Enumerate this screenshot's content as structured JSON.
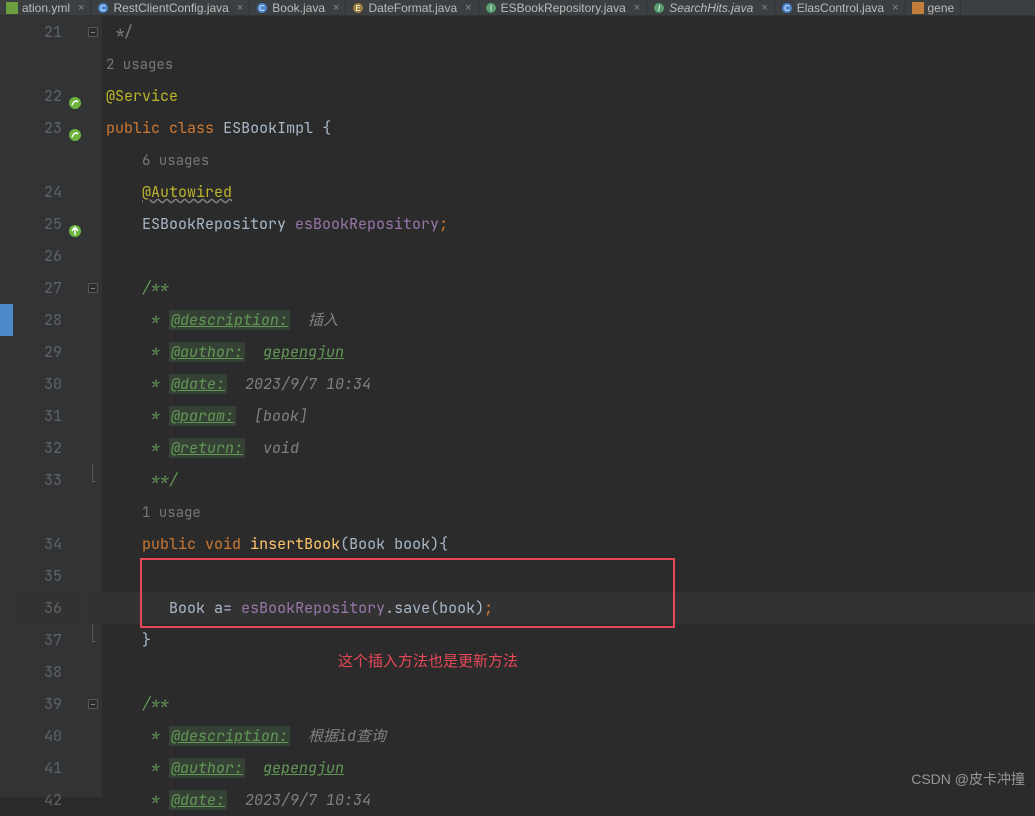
{
  "tabs": [
    {
      "label": "ation.yml",
      "icon": "yml",
      "close": true,
      "italic": false
    },
    {
      "label": "RestClientConfig.java",
      "icon": "java-class",
      "close": true,
      "italic": false
    },
    {
      "label": "Book.java",
      "icon": "java-class",
      "close": true,
      "italic": false
    },
    {
      "label": "DateFormat.java",
      "icon": "java-enum",
      "close": true,
      "italic": false
    },
    {
      "label": "ESBookRepository.java",
      "icon": "java-interface",
      "close": true,
      "italic": false
    },
    {
      "label": "SearchHits.java",
      "icon": "java-interface",
      "close": true,
      "italic": true
    },
    {
      "label": "ElasControl.java",
      "icon": "java-class",
      "close": true,
      "italic": false
    },
    {
      "label": "gene",
      "icon": "xml",
      "close": false,
      "italic": false
    }
  ],
  "watermark": "CSDN @皮卡冲撞",
  "annotation": {
    "text": "这个插入方法也是更新方法"
  },
  "lines": [
    {
      "ln": "21",
      "marks": [
        "fold-minus"
      ],
      "tokens": [
        {
          "t": " */",
          "cls": "c-c"
        }
      ]
    },
    {
      "ln": "",
      "tokens": [
        {
          "t": "2 usages",
          "cls": "c-usage"
        }
      ]
    },
    {
      "ln": "22",
      "gicon": "green-spring",
      "tokens": [
        {
          "t": "@Service",
          "cls": "c-ann"
        }
      ]
    },
    {
      "ln": "23",
      "gicon": "green-spring-arrow",
      "tokens": [
        {
          "t": "public",
          "cls": "c-key"
        },
        {
          "t": " "
        },
        {
          "t": "class",
          "cls": "c-key"
        },
        {
          "t": " "
        },
        {
          "t": "ESBookImpl",
          "cls": "c-type"
        },
        {
          "t": " {",
          "cls": "c-type"
        }
      ]
    },
    {
      "ln": "",
      "tokens": [
        {
          "t": "    ",
          "cls": ""
        },
        {
          "t": "6 usages",
          "cls": "c-usage"
        }
      ]
    },
    {
      "ln": "24",
      "tokens": [
        {
          "t": "    "
        },
        {
          "t": "@Autowired",
          "cls": "c-ann wavy"
        }
      ]
    },
    {
      "ln": "25",
      "gicon": "green-spring-up",
      "tokens": [
        {
          "t": "    "
        },
        {
          "t": "ESBookRepository",
          "cls": "c-type"
        },
        {
          "t": " "
        },
        {
          "t": "esBookRepository",
          "cls": "c-field"
        },
        {
          "t": ";",
          "cls": "c-key"
        }
      ]
    },
    {
      "ln": "26",
      "tokens": [
        {
          "t": ""
        }
      ]
    },
    {
      "ln": "27",
      "marks": [
        "fold-minus",
        "indent-guide"
      ],
      "tokens": [
        {
          "t": "    "
        },
        {
          "t": "/**",
          "cls": "c-doc"
        }
      ]
    },
    {
      "ln": "28",
      "tokens": [
        {
          "t": "     * ",
          "cls": "c-doc"
        },
        {
          "t": "@description:",
          "cls": "c-doc-tag"
        },
        {
          "t": "  ",
          "cls": "c-doc"
        },
        {
          "t": "插入",
          "cls": "c-ci"
        }
      ]
    },
    {
      "ln": "29",
      "tokens": [
        {
          "t": "     * ",
          "cls": "c-doc"
        },
        {
          "t": "@author:",
          "cls": "c-doc-tag"
        },
        {
          "t": "  ",
          "cls": "c-doc"
        },
        {
          "t": "gepengjun",
          "cls": "c-doc-tag2"
        }
      ]
    },
    {
      "ln": "30",
      "tokens": [
        {
          "t": "     * ",
          "cls": "c-doc"
        },
        {
          "t": "@date:",
          "cls": "c-doc-tag"
        },
        {
          "t": "  ",
          "cls": "c-doc"
        },
        {
          "t": "2023/9/7 10:34",
          "cls": "c-ci"
        }
      ]
    },
    {
      "ln": "31",
      "tokens": [
        {
          "t": "     * ",
          "cls": "c-doc"
        },
        {
          "t": "@param:",
          "cls": "c-doc-tag"
        },
        {
          "t": "  ",
          "cls": "c-doc"
        },
        {
          "t": "[book]",
          "cls": "c-ci"
        }
      ]
    },
    {
      "ln": "32",
      "tokens": [
        {
          "t": "     * ",
          "cls": "c-doc"
        },
        {
          "t": "@return:",
          "cls": "c-doc-tag"
        },
        {
          "t": "  ",
          "cls": "c-doc"
        },
        {
          "t": "void",
          "cls": "c-ci"
        }
      ]
    },
    {
      "ln": "33",
      "marks": [
        "fold-end"
      ],
      "tokens": [
        {
          "t": "     **/",
          "cls": "c-doc"
        }
      ]
    },
    {
      "ln": "",
      "tokens": [
        {
          "t": "    ",
          "cls": ""
        },
        {
          "t": "1 usage",
          "cls": "c-usage"
        }
      ]
    },
    {
      "ln": "34",
      "tokens": [
        {
          "t": "    "
        },
        {
          "t": "public",
          "cls": "c-key"
        },
        {
          "t": " "
        },
        {
          "t": "void",
          "cls": "c-key"
        },
        {
          "t": " "
        },
        {
          "t": "insertBook",
          "cls": "c-method"
        },
        {
          "t": "("
        },
        {
          "t": "Book",
          "cls": "c-type"
        },
        {
          "t": " book){",
          "cls": "c-type"
        }
      ]
    },
    {
      "ln": "35",
      "tokens": [
        {
          "t": ""
        }
      ]
    },
    {
      "ln": "36",
      "current": true,
      "tokens": [
        {
          "t": "       "
        },
        {
          "t": "Book",
          "cls": "c-type"
        },
        {
          "t": " "
        },
        {
          "t": "a",
          "cls": "c-type"
        },
        {
          "t": "= "
        },
        {
          "t": "esBookRepository",
          "cls": "c-field"
        },
        {
          "t": "."
        },
        {
          "t": "save",
          "cls": "c-type"
        },
        {
          "t": "("
        },
        {
          "t": "book",
          "cls": "c-type"
        },
        {
          "t": ")"
        },
        {
          "t": ";",
          "cls": "c-key"
        }
      ]
    },
    {
      "ln": "37",
      "marks": [
        "fold-end"
      ],
      "tokens": [
        {
          "t": "    }"
        }
      ]
    },
    {
      "ln": "38",
      "tokens": [
        {
          "t": ""
        }
      ]
    },
    {
      "ln": "39",
      "marks": [
        "fold-minus"
      ],
      "tokens": [
        {
          "t": "    "
        },
        {
          "t": "/**",
          "cls": "c-doc"
        }
      ]
    },
    {
      "ln": "40",
      "tokens": [
        {
          "t": "     * ",
          "cls": "c-doc"
        },
        {
          "t": "@description:",
          "cls": "c-doc-tag"
        },
        {
          "t": "  ",
          "cls": "c-doc"
        },
        {
          "t": "根据id查询",
          "cls": "c-ci"
        }
      ]
    },
    {
      "ln": "41",
      "tokens": [
        {
          "t": "     * ",
          "cls": "c-doc"
        },
        {
          "t": "@author:",
          "cls": "c-doc-tag"
        },
        {
          "t": "  ",
          "cls": "c-doc"
        },
        {
          "t": "gepengjun",
          "cls": "c-doc-tag2"
        }
      ]
    },
    {
      "ln": "42",
      "tokens": [
        {
          "t": "     * ",
          "cls": "c-doc"
        },
        {
          "t": "@date:",
          "cls": "c-doc-tag"
        },
        {
          "t": "  ",
          "cls": "c-doc"
        },
        {
          "t": "2023/9/7 10:34",
          "cls": "c-ci"
        }
      ]
    }
  ]
}
